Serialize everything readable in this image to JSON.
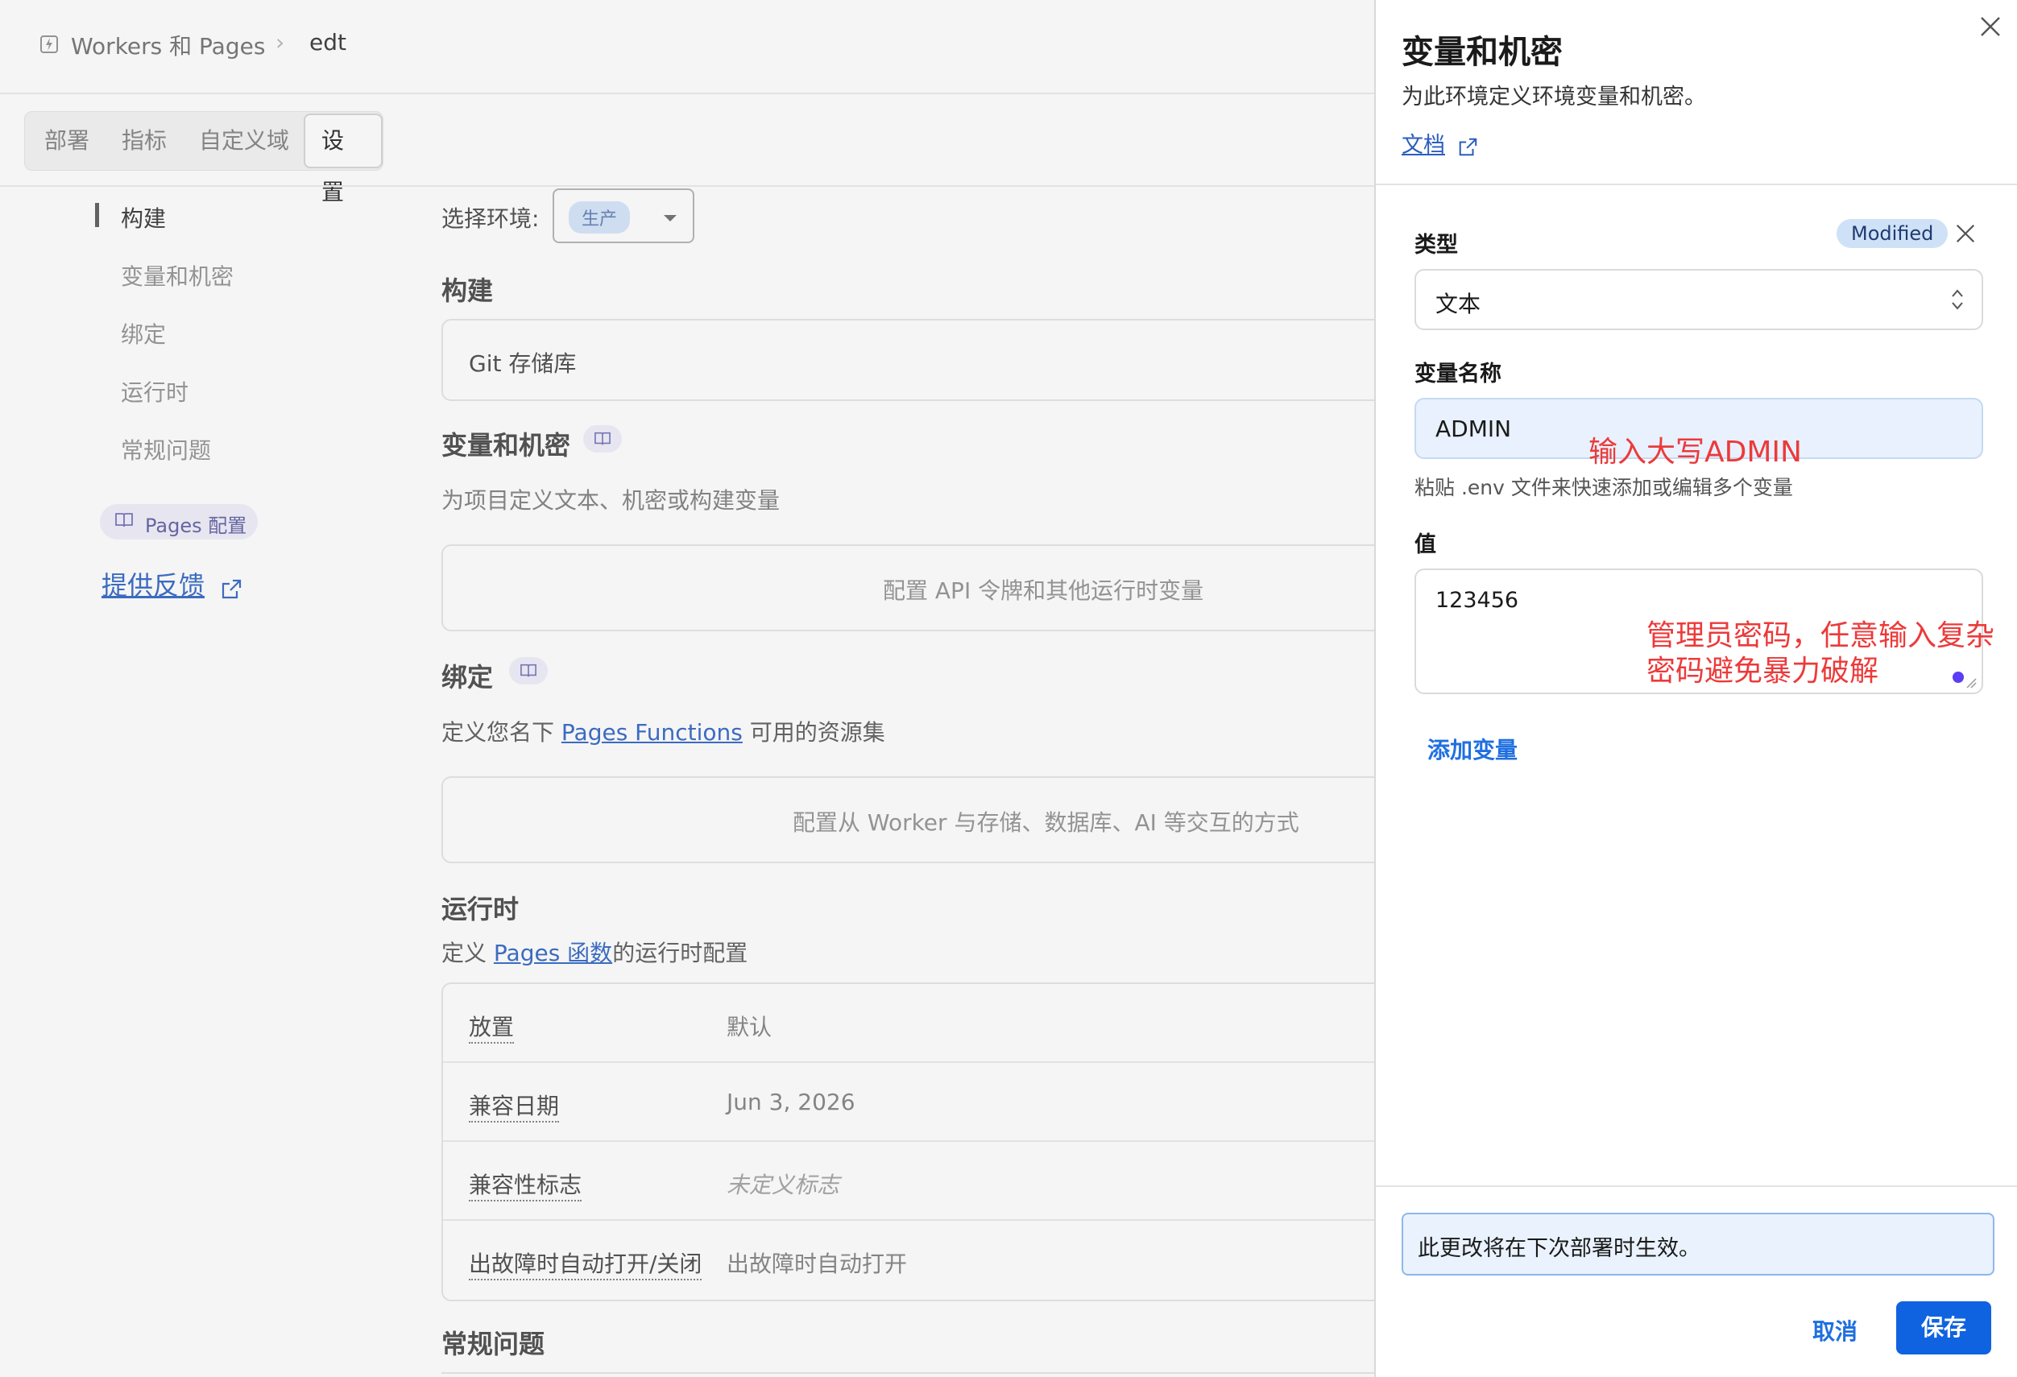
{
  "breadcrumb": {
    "app": "Workers 和 Pages",
    "separator": "›",
    "project": "edt"
  },
  "tabs": [
    "部署",
    "指标",
    "自定义域",
    "设置"
  ],
  "active_tab_index": 3,
  "side_nav": {
    "items": [
      "构建",
      "变量和机密",
      "绑定",
      "运行时",
      "常规问题"
    ],
    "active_index": 0,
    "pages_config": "Pages 配置",
    "feedback": "提供反馈"
  },
  "env_select": {
    "label": "选择环境:",
    "value": "生产"
  },
  "sections": {
    "build": {
      "title": "构建",
      "card": "Git 存储库"
    },
    "vars": {
      "title": "变量和机密",
      "desc": "为项目定义文本、机密或构建变量",
      "card": "配置 API 令牌和其他运行时变量"
    },
    "bindings": {
      "title": "绑定",
      "desc_pre": "定义您名下 ",
      "desc_link": "Pages Functions",
      "desc_post": " 可用的资源集",
      "card": "配置从 Worker 与存储、数据库、AI 等交互的方式"
    },
    "runtime": {
      "title": "运行时",
      "desc_pre": "定义 ",
      "desc_link": "Pages 函数",
      "desc_post": "的运行时配置",
      "rows": [
        {
          "label": "放置",
          "value": "默认"
        },
        {
          "label": "兼容日期",
          "value": "Jun 3, 2026"
        },
        {
          "label": "兼容性标志",
          "value": "未定义标志"
        },
        {
          "label": "出故障时自动打开/关闭",
          "value": "出故障时自动打开"
        }
      ]
    },
    "general": {
      "title": "常规问题"
    }
  },
  "drawer": {
    "title": "变量和机密",
    "subtitle": "为此环境定义环境变量和机密。",
    "doc_link": "文档",
    "type_label": "类型",
    "modified_badge": "Modified",
    "type_value": "文本",
    "name_label": "变量名称",
    "name_value": "ADMIN",
    "name_annotation": "输入大写ADMIN",
    "name_hint": "粘贴 .env 文件来快速添加或编辑多个变量",
    "value_label": "值",
    "value_value": "123456",
    "value_annotation_line1": "管理员密码，任意输入复杂",
    "value_annotation_line2": "密码避免暴力破解",
    "add_variable": "添加变量",
    "info": "此更改将在下次部署时生效。",
    "cancel": "取消",
    "save": "保存"
  },
  "colors": {
    "accent": "#0f63e0",
    "link": "#3f70c8",
    "annotation_red": "#ec3a3a",
    "badge_bg": "#cfe1f7",
    "info_bg": "#e9f2fd"
  }
}
